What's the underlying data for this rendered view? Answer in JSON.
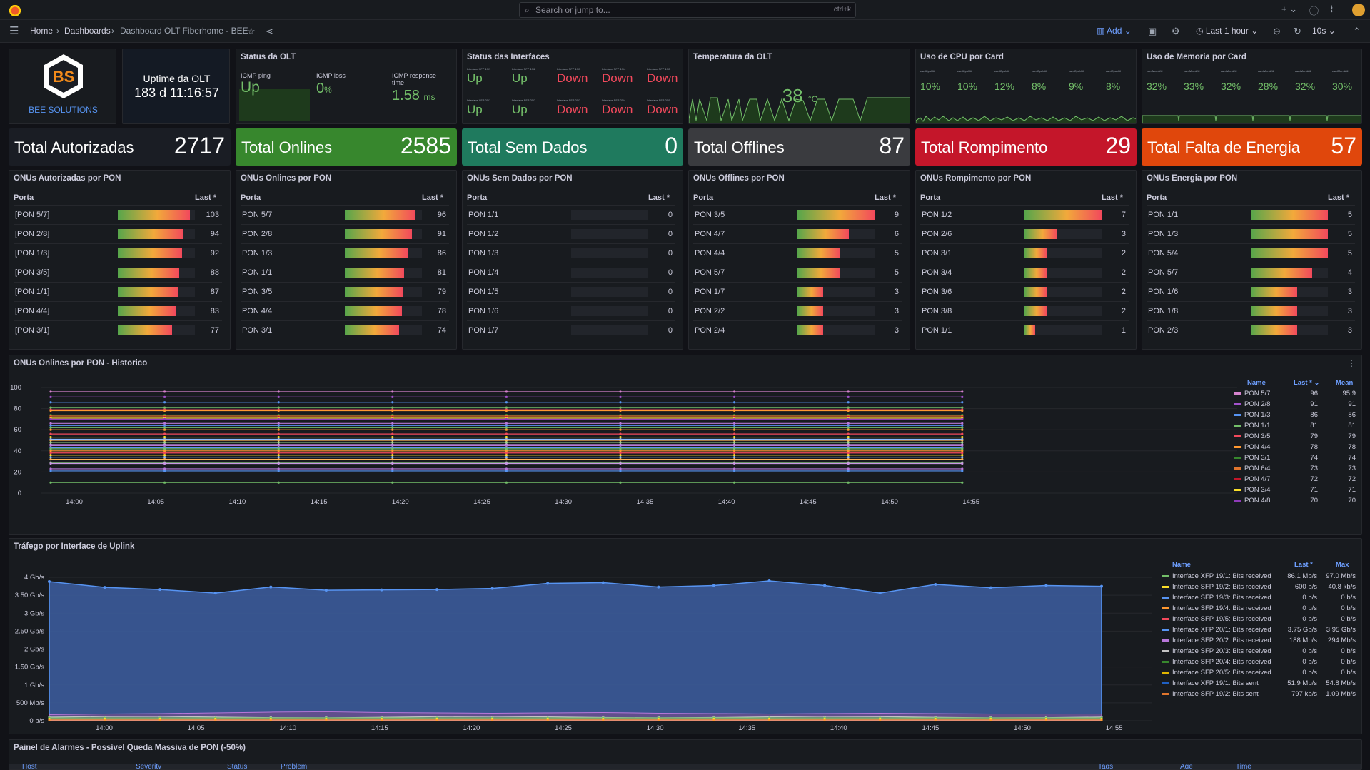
{
  "topbar": {
    "search_placeholder": "Search or jump to...",
    "search_shortcut": "ctrl+k",
    "plus": "+",
    "help": "?"
  },
  "breadcrumb": {
    "home": "Home",
    "dashboards": "Dashboards",
    "current": "Dashboard OLT Fiberhome - BEE"
  },
  "toolbar": {
    "add": "Add",
    "time_range": "Last 1 hour",
    "refresh": "10s"
  },
  "brand": {
    "name": "BEE SOLUTIONS"
  },
  "uptime": {
    "title": "Uptime da OLT",
    "value": "183 d 11:16:57"
  },
  "status_olt": {
    "title": "Status da OLT",
    "icmp_ping_label": "ICMP ping",
    "icmp_ping": "Up",
    "icmp_loss_label": "ICMP loss",
    "icmp_loss": "0",
    "icmp_loss_unit": "%",
    "icmp_resp_label": "ICMP response time",
    "icmp_resp": "1.58",
    "icmp_resp_unit": "ms"
  },
  "interfaces": {
    "title": "Status das Interfaces",
    "items": [
      {
        "label": "Interface XFP 19/1",
        "status": "Up"
      },
      {
        "label": "Interface SFP 19/2",
        "status": "Up"
      },
      {
        "label": "Interface SFP 19/3",
        "status": "Down"
      },
      {
        "label": "Interface SFP 19/4",
        "status": "Down"
      },
      {
        "label": "Interface SFP 19/5",
        "status": "Down"
      },
      {
        "label": "Interface XFP 20/1",
        "status": "Up"
      },
      {
        "label": "Interface SFP 20/2",
        "status": "Up"
      },
      {
        "label": "Interface SFP 20/3",
        "status": "Down"
      },
      {
        "label": "Interface SFP 20/4",
        "status": "Down"
      },
      {
        "label": "Interface SFP 20/5",
        "status": "Down"
      }
    ]
  },
  "temperature": {
    "title": "Temperatura da OLT",
    "value": "38",
    "unit": "°C"
  },
  "cpu": {
    "title": "Uso de CPU por Card",
    "items": [
      {
        "label": "cardCpuUtil",
        "value": "10%"
      },
      {
        "label": "cardCpuUtil",
        "value": "10%"
      },
      {
        "label": "cardCpuUtil",
        "value": "12%"
      },
      {
        "label": "cardCpuUtil",
        "value": "8%"
      },
      {
        "label": "cardCpuUtil",
        "value": "9%"
      },
      {
        "label": "cardCpuUtil",
        "value": "8%"
      }
    ]
  },
  "mem": {
    "title": "Uso de Memoria por Card",
    "items": [
      {
        "label": "cardMemUtil",
        "value": "32%"
      },
      {
        "label": "cardMemUtil",
        "value": "33%"
      },
      {
        "label": "cardMemUtil",
        "value": "32%"
      },
      {
        "label": "cardMemUtil",
        "value": "28%"
      },
      {
        "label": "cardMemUtil",
        "value": "32%"
      },
      {
        "label": "cardMemUtil",
        "value": "30%"
      }
    ]
  },
  "totals": [
    {
      "label": "Total Autorizadas",
      "value": "2717",
      "color": "#1a1d24"
    },
    {
      "label": "Total Onlines",
      "value": "2585",
      "color": "#37872d"
    },
    {
      "label": "Total Sem Dados",
      "value": "0",
      "color": "#1f7a5e"
    },
    {
      "label": "Total Offlines",
      "value": "87",
      "color": "#3a3b3f"
    },
    {
      "label": "Total Rompimento",
      "value": "29",
      "color": "#c4162a"
    },
    {
      "label": "Total Falta de Energia",
      "value": "57",
      "color": "#e0470c"
    }
  ],
  "bargauges": [
    {
      "title": "ONUs Autorizadas por PON",
      "col_port": "Porta",
      "col_last": "Last *",
      "max": 110,
      "rows": [
        [
          "[PON 5/7]",
          103
        ],
        [
          "[PON 2/8]",
          94
        ],
        [
          "[PON 1/3]",
          92
        ],
        [
          "[PON 3/5]",
          88
        ],
        [
          "[PON 1/1]",
          87
        ],
        [
          "[PON 4/4]",
          83
        ],
        [
          "[PON 3/1]",
          77
        ]
      ]
    },
    {
      "title": "ONUs Onlines por PON",
      "col_port": "Porta",
      "col_last": "Last *",
      "max": 105,
      "rows": [
        [
          "PON 5/7",
          96
        ],
        [
          "PON 2/8",
          91
        ],
        [
          "PON 1/3",
          86
        ],
        [
          "PON 1/1",
          81
        ],
        [
          "PON 3/5",
          79
        ],
        [
          "PON 4/4",
          78
        ],
        [
          "PON 3/1",
          74
        ]
      ]
    },
    {
      "title": "ONUs Sem Dados por PON",
      "col_port": "Porta",
      "col_last": "Last *",
      "max": 10,
      "rows": [
        [
          "PON 1/1",
          0
        ],
        [
          "PON 1/2",
          0
        ],
        [
          "PON 1/3",
          0
        ],
        [
          "PON 1/4",
          0
        ],
        [
          "PON 1/5",
          0
        ],
        [
          "PON 1/6",
          0
        ],
        [
          "PON 1/7",
          0
        ]
      ]
    },
    {
      "title": "ONUs Offlines por PON",
      "col_port": "Porta",
      "col_last": "Last *",
      "max": 9,
      "rows": [
        [
          "PON 3/5",
          9
        ],
        [
          "PON 4/7",
          6
        ],
        [
          "PON 4/4",
          5
        ],
        [
          "PON 5/7",
          5
        ],
        [
          "PON 1/7",
          3
        ],
        [
          "PON 2/2",
          3
        ],
        [
          "PON 2/4",
          3
        ]
      ]
    },
    {
      "title": "ONUs Rompimento por PON",
      "col_port": "Porta",
      "col_last": "Last *",
      "max": 7,
      "rows": [
        [
          "PON 1/2",
          7
        ],
        [
          "PON 2/6",
          3
        ],
        [
          "PON 3/1",
          2
        ],
        [
          "PON 3/4",
          2
        ],
        [
          "PON 3/6",
          2
        ],
        [
          "PON 3/8",
          2
        ],
        [
          "PON 1/1",
          1
        ]
      ]
    },
    {
      "title": "ONUs Energia por PON",
      "col_port": "Porta",
      "col_last": "Last *",
      "max": 5,
      "rows": [
        [
          "PON 1/1",
          5
        ],
        [
          "PON 1/3",
          5
        ],
        [
          "PON 5/4",
          5
        ],
        [
          "PON 5/7",
          4
        ],
        [
          "PON 1/6",
          3
        ],
        [
          "PON 1/8",
          3
        ],
        [
          "PON 2/3",
          3
        ]
      ]
    }
  ],
  "history": {
    "title": "ONUs Onlines por PON - Historico",
    "legend_name": "Name",
    "legend_last": "Last *",
    "legend_mean": "Mean",
    "chart_data": {
      "type": "line",
      "x": [
        "14:00",
        "14:05",
        "14:10",
        "14:15",
        "14:20",
        "14:25",
        "14:30",
        "14:35",
        "14:40",
        "14:45",
        "14:50",
        "14:55"
      ],
      "ylim": [
        0,
        100
      ],
      "yticks": [
        0,
        20,
        40,
        60,
        80,
        100
      ],
      "series": [
        {
          "name": "PON 5/7",
          "last": 96,
          "mean": 95.9,
          "color": "#d683ce"
        },
        {
          "name": "PON 2/8",
          "last": 91,
          "mean": 91,
          "color": "#a352cc"
        },
        {
          "name": "PON 1/3",
          "last": 86,
          "mean": 86,
          "color": "#5794f2"
        },
        {
          "name": "PON 1/1",
          "last": 81,
          "mean": 81,
          "color": "#73bf69"
        },
        {
          "name": "PON 3/5",
          "last": 79,
          "mean": 79,
          "color": "#f2495c"
        },
        {
          "name": "PON 4/4",
          "last": 78,
          "mean": 78,
          "color": "#ff9830"
        },
        {
          "name": "PON 3/1",
          "last": 74,
          "mean": 74,
          "color": "#37872d"
        },
        {
          "name": "PON 6/4",
          "last": 73,
          "mean": 73,
          "color": "#e0752d"
        },
        {
          "name": "PON 4/7",
          "last": 72,
          "mean": 72,
          "color": "#c4162a"
        },
        {
          "name": "PON 3/4",
          "last": 71,
          "mean": 71,
          "color": "#fade2a"
        },
        {
          "name": "PON 4/8",
          "last": 70,
          "mean": 70,
          "color": "#8f3bb8"
        }
      ],
      "extra_levels": [
        66,
        64,
        62,
        60,
        56,
        53,
        51,
        50,
        48,
        46,
        45,
        43,
        42,
        40,
        38,
        36,
        34,
        32,
        29,
        28,
        23,
        21,
        10
      ]
    }
  },
  "traffic": {
    "title": "Tráfego por Interface de Uplink",
    "legend_name": "Name",
    "legend_last": "Last *",
    "legend_max": "Max",
    "chart_data": {
      "type": "area",
      "x": [
        "14:00",
        "14:05",
        "14:10",
        "14:15",
        "14:20",
        "14:25",
        "14:30",
        "14:35",
        "14:40",
        "14:45",
        "14:50",
        "14:55"
      ],
      "yticks": [
        "0 b/s",
        "500 Mb/s",
        "1 Gb/s",
        "1.50 Gb/s",
        "2 Gb/s",
        "2.50 Gb/s",
        "3 Gb/s",
        "3.50 Gb/s",
        "4 Gb/s"
      ],
      "ylim": [
        0,
        4
      ],
      "main_series_gbps": [
        3.88,
        3.72,
        3.66,
        3.56,
        3.73,
        3.64,
        3.65,
        3.66,
        3.69,
        3.83,
        3.85,
        3.73,
        3.77,
        3.9,
        3.77,
        3.56,
        3.8,
        3.71,
        3.77,
        3.75
      ],
      "sent_series_gbps": [
        0.17,
        0.19,
        0.2,
        0.22,
        0.24,
        0.25,
        0.23,
        0.22,
        0.21,
        0.22,
        0.23,
        0.21,
        0.2,
        0.19,
        0.2,
        0.21,
        0.2,
        0.19,
        0.19,
        0.19
      ],
      "series": [
        {
          "name": "Interface XFP 19/1: Bits received",
          "last": "86.1 Mb/s",
          "max": "97.0 Mb/s",
          "color": "#73bf69"
        },
        {
          "name": "Interface SFP 19/2: Bits received",
          "last": "600 b/s",
          "max": "40.8 kb/s",
          "color": "#fade2a"
        },
        {
          "name": "Interface SFP 19/3: Bits received",
          "last": "0 b/s",
          "max": "0 b/s",
          "color": "#5794f2"
        },
        {
          "name": "Interface SFP 19/4: Bits received",
          "last": "0 b/s",
          "max": "0 b/s",
          "color": "#ff9830"
        },
        {
          "name": "Interface SFP 19/5: Bits received",
          "last": "0 b/s",
          "max": "0 b/s",
          "color": "#f2495c"
        },
        {
          "name": "Interface XFP 20/1: Bits received",
          "last": "3.75 Gb/s",
          "max": "3.95 Gb/s",
          "color": "#5794f2"
        },
        {
          "name": "Interface SFP 20/2: Bits received",
          "last": "188 Mb/s",
          "max": "294 Mb/s",
          "color": "#b877d9"
        },
        {
          "name": "Interface SFP 20/3: Bits received",
          "last": "0 b/s",
          "max": "0 b/s",
          "color": "#c4c4c4"
        },
        {
          "name": "Interface SFP 20/4: Bits received",
          "last": "0 b/s",
          "max": "0 b/s",
          "color": "#37872d"
        },
        {
          "name": "Interface SFP 20/5: Bits received",
          "last": "0 b/s",
          "max": "0 b/s",
          "color": "#e0b400"
        },
        {
          "name": "Interface XFP 19/1: Bits sent",
          "last": "51.9 Mb/s",
          "max": "54.8 Mb/s",
          "color": "#1f60c4"
        },
        {
          "name": "Interface SFP 19/2: Bits sent",
          "last": "797 kb/s",
          "max": "1.09 Mb/s",
          "color": "#e0752d"
        }
      ]
    }
  },
  "alarms": {
    "title": "Painel de Alarmes - Possível Queda Massiva de PON (-50%)",
    "cols": [
      "Host",
      "Severity",
      "Status",
      "Problem",
      "Tags",
      "Age",
      "Time"
    ]
  }
}
